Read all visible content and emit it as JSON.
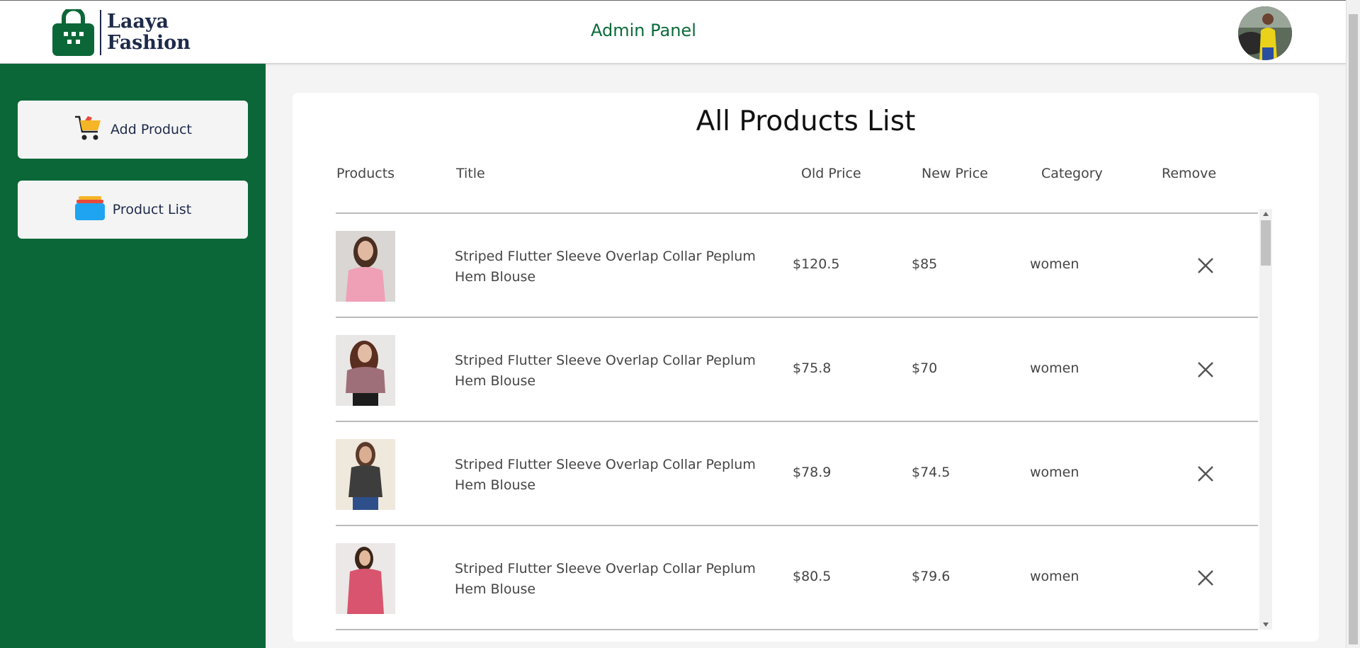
{
  "header": {
    "brand_line1": "Laaya",
    "brand_line2": "Fashion",
    "title": "Admin Panel",
    "avatar_icon": "user-avatar"
  },
  "sidebar": {
    "items": [
      {
        "label": "Add Product",
        "icon": "cart-icon"
      },
      {
        "label": "Product List",
        "icon": "stack-icon"
      }
    ]
  },
  "main": {
    "title": "All Products List",
    "columns": [
      "Products",
      "Title",
      "Old Price",
      "New Price",
      "Category",
      "Remove"
    ],
    "rows": [
      {
        "title": "Striped Flutter Sleeve Overlap Collar Peplum Hem Blouse",
        "old_price": "$120.5",
        "new_price": "$85",
        "category": "women"
      },
      {
        "title": "Striped Flutter Sleeve Overlap Collar Peplum Hem Blouse",
        "old_price": "$75.8",
        "new_price": "$70",
        "category": "women"
      },
      {
        "title": "Striped Flutter Sleeve Overlap Collar Peplum Hem Blouse",
        "old_price": "$78.9",
        "new_price": "$74.5",
        "category": "women"
      },
      {
        "title": "Striped Flutter Sleeve Overlap Collar Peplum Hem Blouse",
        "old_price": "$80.5",
        "new_price": "$79.6",
        "category": "women"
      }
    ]
  },
  "colors": {
    "brand_green": "#0b6737",
    "title_green": "#0b6b3a",
    "logo_navy": "#1e2a4a"
  }
}
